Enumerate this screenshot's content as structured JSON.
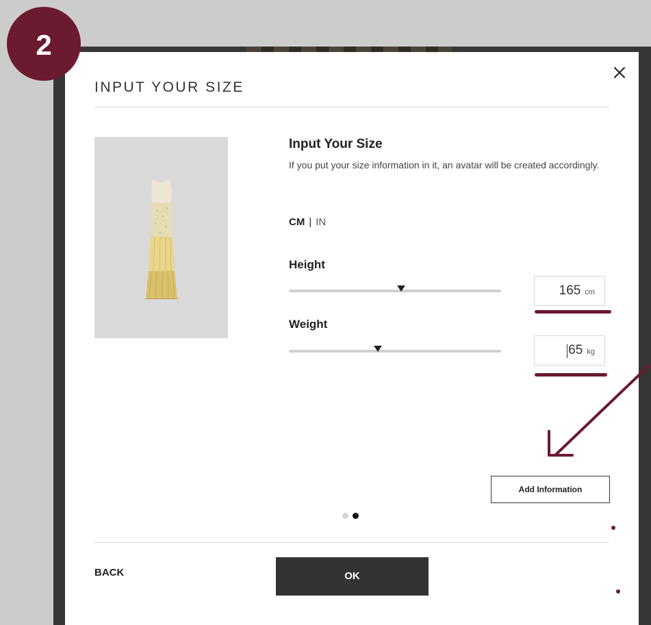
{
  "step_badge": "2",
  "modal": {
    "title": "INPUT YOUR SIZE",
    "section_title": "Input Your Size",
    "description": "If you put your size information in it, an avatar will be created accordingly.",
    "units": {
      "active": "CM",
      "separator": "|",
      "inactive": "IN"
    },
    "height": {
      "label": "Height",
      "value": "165",
      "unit": "cm",
      "slider_fraction": 0.53
    },
    "weight": {
      "label": "Weight",
      "value": "65",
      "unit": "kg",
      "slider_fraction": 0.42
    },
    "add_information_label": "Add Information",
    "pagination": {
      "total": 2,
      "active": 2
    },
    "back_label": "BACK",
    "ok_label": "OK"
  },
  "colors": {
    "accent": "#6b1a30",
    "button_dark": "#333333",
    "backdrop": "#cccccc"
  },
  "icons": {
    "close": "close-icon",
    "annotation_arrow": "arrow-icon"
  }
}
